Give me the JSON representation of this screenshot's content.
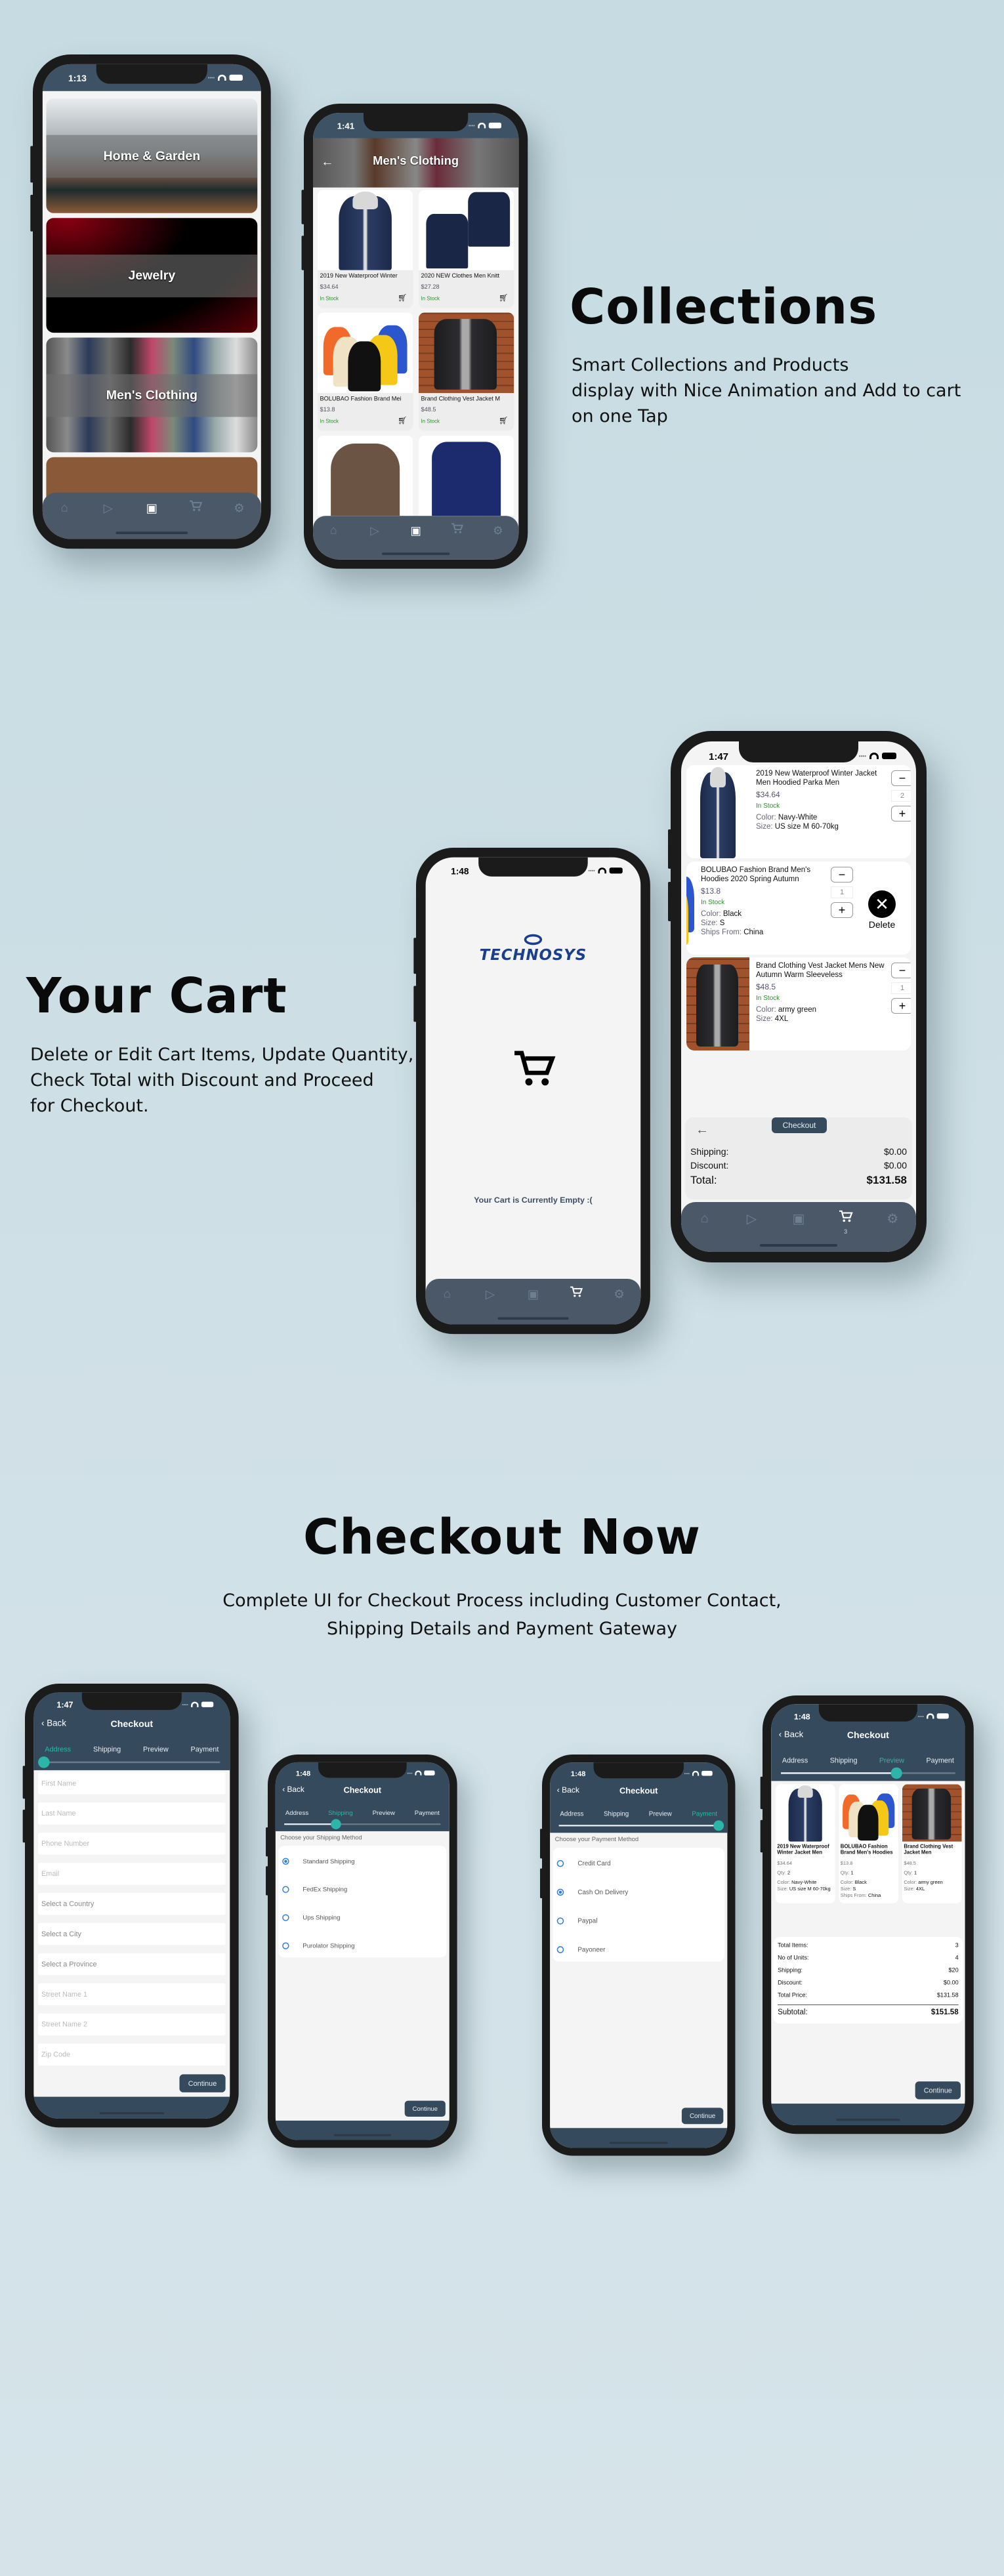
{
  "colors": {
    "accent": "#2cb5a8",
    "header": "#364a5e",
    "tabbar": "#4a5868",
    "in_stock": "#2e8b2e",
    "radio": "#2e7de6",
    "background": "#c9dce3"
  },
  "collections_section": {
    "title": "Collections",
    "lines": [
      "Smart Collections and Products",
      "display with Nice Animation and Add to cart",
      "on one Tap"
    ]
  },
  "cart_section": {
    "title": "Your Cart",
    "lines": [
      "Delete or Edit Cart Items, Update Quantity,",
      "Check Total with Discount and Proceed",
      "for Checkout."
    ]
  },
  "checkout_section": {
    "title": "Checkout Now",
    "lines": [
      "Complete UI for Checkout Process including Customer Contact,",
      "Shipping Details and Payment Gateway"
    ]
  },
  "tabbar_icons": [
    "home-icon",
    "tag-icon",
    "collections-icon",
    "cart-icon",
    "settings-icon"
  ],
  "checkout_common": {
    "back": "Back",
    "title": "Checkout",
    "steps": [
      "Address",
      "Shipping",
      "Preview",
      "Payment"
    ],
    "continue": "Continue"
  },
  "phones": {
    "categories": {
      "time": "1:13",
      "items": [
        "Home & Garden",
        "Jewelry",
        "Men's Clothing"
      ]
    },
    "products": {
      "time": "1:41",
      "title": "Men's Clothing",
      "items": [
        {
          "name": "2019 New Waterproof Winter",
          "price": "$34.64",
          "stock": "In Stock"
        },
        {
          "name": "2020 NEW Clothes Men Knitt",
          "price": "$27.28",
          "stock": "In Stock"
        },
        {
          "name": "BOLUBAO Fashion Brand Mei",
          "price": "$13.8",
          "stock": "In Stock"
        },
        {
          "name": "Brand Clothing Vest Jacket M",
          "price": "$48.5",
          "stock": "In Stock"
        }
      ]
    },
    "empty_cart": {
      "time": "1:48",
      "logo": "TECHNOSYS",
      "message": "Your Cart is Currently Empty :("
    },
    "cart": {
      "time": "1:47",
      "badge": "3",
      "delete_label": "Delete",
      "checkout_label": "Checkout",
      "items": [
        {
          "name": "2019 New Waterproof Winter Jacket Men Hoodied Parka Men",
          "price": "$34.64",
          "stock": "In Stock",
          "qty": "2",
          "attrs": [
            [
              "Color: ",
              "Navy-White"
            ],
            [
              "Size: ",
              "US size M 60-70kg"
            ]
          ]
        },
        {
          "name": "BOLUBAO Fashion Brand Men's Hoodies 2020 Spring Autumn",
          "price": "$13.8",
          "stock": "In Stock",
          "qty": "1",
          "attrs": [
            [
              "Color: ",
              "Black"
            ],
            [
              "Size: ",
              "S"
            ],
            [
              "Ships From: ",
              "China"
            ]
          ]
        },
        {
          "name": "Brand Clothing Vest Jacket Mens New Autumn Warm Sleeveless",
          "price": "$48.5",
          "stock": "In Stock",
          "qty": "1",
          "attrs": [
            [
              "Color: ",
              "army green"
            ],
            [
              "Size: ",
              "4XL"
            ]
          ]
        }
      ],
      "summary": [
        [
          "Shipping:",
          "$0.00"
        ],
        [
          "Discount:",
          "$0.00"
        ],
        [
          "Total:",
          "$131.58"
        ]
      ]
    },
    "address": {
      "time": "1:47",
      "active_step": 0,
      "fields": [
        {
          "label": "First Name",
          "type": "input"
        },
        {
          "label": "Last Name",
          "type": "input"
        },
        {
          "label": "Phone Number",
          "type": "input"
        },
        {
          "label": "Email",
          "type": "input"
        },
        {
          "label": "Select a Country",
          "type": "select"
        },
        {
          "label": "Select a City",
          "type": "select"
        },
        {
          "label": "Select a Province",
          "type": "select"
        },
        {
          "label": "Street Name 1",
          "type": "input"
        },
        {
          "label": "Street Name 2",
          "type": "input"
        },
        {
          "label": "Zip Code",
          "type": "input"
        }
      ]
    },
    "shipping": {
      "time": "1:48",
      "active_step": 1,
      "heading": "Choose your Shipping Method",
      "selected": 0,
      "options": [
        "Standard Shipping",
        "FedEx Shipping",
        "Ups Shipping",
        "Purolator Shipping"
      ]
    },
    "payment": {
      "time": "1:48",
      "active_step": 3,
      "heading": "Choose your Payment Method",
      "selected": 1,
      "options": [
        "Credit Card",
        "Cash On Delivery",
        "Paypal",
        "Payoneer"
      ]
    },
    "preview": {
      "time": "1:48",
      "active_step": 2,
      "items": [
        {
          "name": "2019 New Waterproof Winter Jacket Men",
          "price": "$34.64",
          "qty": "2",
          "attrs": [
            [
              "Color: ",
              "Navy-White"
            ],
            [
              "Size: ",
              "US size M 60-70kg"
            ]
          ]
        },
        {
          "name": "BOLUBAO Fashion Brand Men's Hoodies",
          "price": "$13.8",
          "qty": "1",
          "attrs": [
            [
              "Color: ",
              "Black"
            ],
            [
              "Size: ",
              "S"
            ],
            [
              "Ships From: ",
              "China"
            ]
          ]
        },
        {
          "name": "Brand Clothing Vest Jacket Men",
          "price": "$48.5",
          "qty": "1",
          "attrs": [
            [
              "Color: ",
              "army green"
            ],
            [
              "Size: ",
              "4XL"
            ]
          ]
        }
      ],
      "qty_label": "Qty: ",
      "summary": [
        [
          "Total Items:",
          "3"
        ],
        [
          "No of Units:",
          "4"
        ],
        [
          "Shipping:",
          "$20"
        ],
        [
          "Discount:",
          "$0.00"
        ],
        [
          "Total Price:",
          "$131.58"
        ]
      ],
      "subtotal": [
        "Subtotal:",
        "$151.58"
      ]
    }
  }
}
